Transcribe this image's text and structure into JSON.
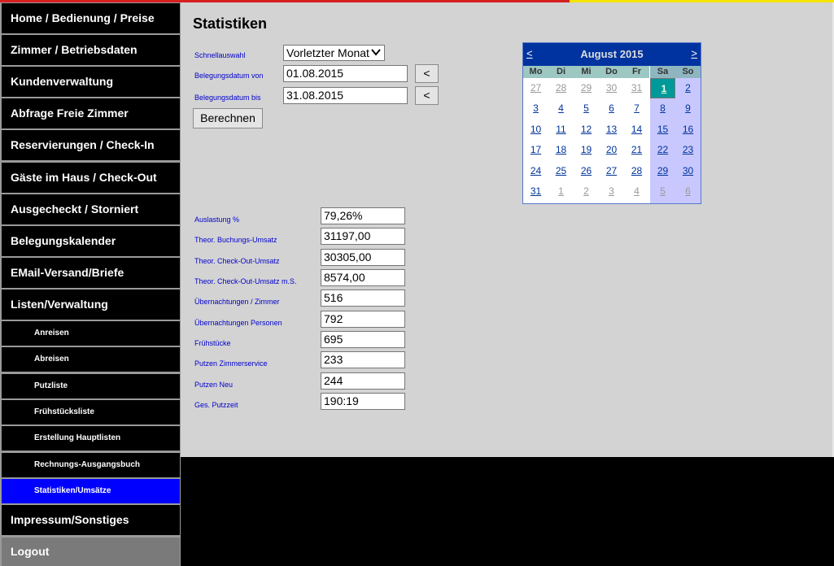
{
  "nav": {
    "items": [
      {
        "label": "Home / Bedienung / Preise"
      },
      {
        "label": "Zimmer / Betriebsdaten"
      },
      {
        "label": "Kundenverwaltung"
      },
      {
        "label": "Abfrage Freie Zimmer"
      },
      {
        "label": "Reservierungen / Check-In"
      },
      {
        "label": "Gäste im Haus / Check-Out"
      },
      {
        "label": "Ausgecheckt / Storniert"
      },
      {
        "label": "Belegungskalender"
      },
      {
        "label": "EMail-Versand/Briefe"
      },
      {
        "label": "Listen/Verwaltung"
      }
    ],
    "sub_items": [
      {
        "label": "Anreisen"
      },
      {
        "label": "Abreisen"
      },
      {
        "label": "Putzliste"
      },
      {
        "label": "Frühstücksliste"
      },
      {
        "label": "Erstellung Hauptlisten"
      },
      {
        "label": "Rechnungs-Ausgangsbuch"
      },
      {
        "label": "Statistiken/Umsätze"
      }
    ],
    "bottom_items": [
      {
        "label": "Impressum/Sonstiges"
      },
      {
        "label": "Logout"
      }
    ],
    "active_color": "#0000ff"
  },
  "page": {
    "title": "Statistiken"
  },
  "form": {
    "schnellauswahl_label": "Schnellauswahl",
    "schnellauswahl_value": "Vorletzter Monat",
    "von_label": "Belegungsdatum von",
    "von_value": "01.08.2015",
    "bis_label": "Belegungsdatum bis",
    "bis_value": "31.08.2015",
    "picker_label": "<",
    "berechnen_label": "Berechnen"
  },
  "calendar": {
    "prev": "<",
    "next": ">",
    "month_label": "August 2015",
    "weekdays": [
      "Mo",
      "Di",
      "Mi",
      "Do",
      "Fr",
      "Sa",
      "So"
    ],
    "weeks": [
      [
        [
          "27",
          true
        ],
        [
          "28",
          true
        ],
        [
          "29",
          true
        ],
        [
          "30",
          true
        ],
        [
          "31",
          true
        ],
        [
          "1",
          false
        ],
        [
          "2",
          false
        ]
      ],
      [
        [
          "3",
          false
        ],
        [
          "4",
          false
        ],
        [
          "5",
          false
        ],
        [
          "6",
          false
        ],
        [
          "7",
          false
        ],
        [
          "8",
          false
        ],
        [
          "9",
          false
        ]
      ],
      [
        [
          "10",
          false
        ],
        [
          "11",
          false
        ],
        [
          "12",
          false
        ],
        [
          "13",
          false
        ],
        [
          "14",
          false
        ],
        [
          "15",
          false
        ],
        [
          "16",
          false
        ]
      ],
      [
        [
          "17",
          false
        ],
        [
          "18",
          false
        ],
        [
          "19",
          false
        ],
        [
          "20",
          false
        ],
        [
          "21",
          false
        ],
        [
          "22",
          false
        ],
        [
          "23",
          false
        ]
      ],
      [
        [
          "24",
          false
        ],
        [
          "25",
          false
        ],
        [
          "26",
          false
        ],
        [
          "27",
          false
        ],
        [
          "28",
          false
        ],
        [
          "29",
          false
        ],
        [
          "30",
          false
        ]
      ],
      [
        [
          "31",
          false
        ],
        [
          "1",
          true
        ],
        [
          "2",
          true
        ],
        [
          "3",
          true
        ],
        [
          "4",
          true
        ],
        [
          "5",
          true
        ],
        [
          "6",
          true
        ]
      ]
    ],
    "selected_day": "1"
  },
  "stats": [
    {
      "label": "Auslastung %",
      "value": "79,26%"
    },
    {
      "label": "Theor. Buchungs-Umsatz",
      "value": "31197,00"
    },
    {
      "label": "Theor. Check-Out-Umsatz",
      "value": "30305,00"
    },
    {
      "label": "Theor. Check-Out-Umsatz m.S.",
      "value": "8574,00"
    },
    {
      "label": "Übernachtungen / Zimmer",
      "value": "516"
    },
    {
      "label": "Übernachtungen Personen",
      "value": "792"
    },
    {
      "label": "Frühstücke",
      "value": "695"
    },
    {
      "label": "Putzen Zimmerservice",
      "value": "233"
    },
    {
      "label": "Putzen Neu",
      "value": "244"
    },
    {
      "label": "Ges. Putzzeit",
      "value": "190:19"
    }
  ]
}
